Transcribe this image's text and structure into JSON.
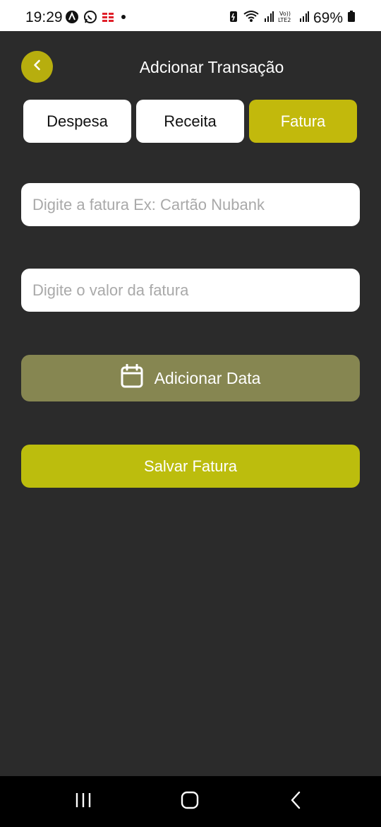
{
  "status_bar": {
    "time": "19:29",
    "battery": "69%",
    "icons": [
      "nav-app-icon",
      "whatsapp-icon",
      "app-notification-icon",
      "dot-icon",
      "battery-saver-icon",
      "wifi-icon",
      "signal-icon",
      "volte-icon",
      "signal-icon-2",
      "battery-icon"
    ]
  },
  "header": {
    "title": "Adcionar Transação",
    "back_icon": "chevron-left-icon"
  },
  "tabs": [
    {
      "label": "Despesa",
      "active": false
    },
    {
      "label": "Receita",
      "active": false
    },
    {
      "label": "Fatura",
      "active": true
    }
  ],
  "form": {
    "fatura_placeholder": "Digite a fatura Ex: Cartão Nubank",
    "fatura_value": "",
    "valor_placeholder": "Digite o valor da fatura",
    "valor_value": "",
    "date_label": "Adicionar Data",
    "date_icon": "calendar-icon",
    "save_label": "Salvar Fatura"
  },
  "nav_bar": {
    "icons": [
      "recent-apps-icon",
      "home-icon",
      "back-icon"
    ]
  },
  "colors": {
    "background": "#2b2b2b",
    "accent": "#c2b90c",
    "date_button": "#868651",
    "save_button": "#bcbd0d"
  }
}
